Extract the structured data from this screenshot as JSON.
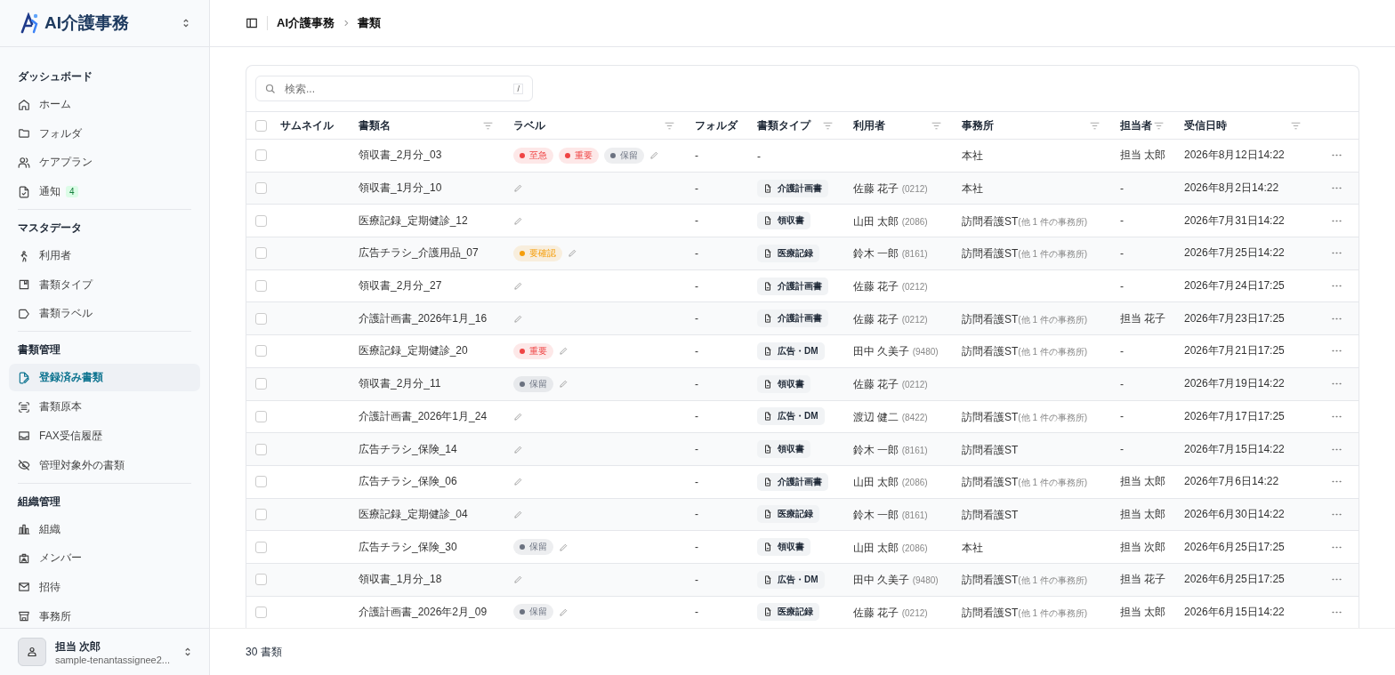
{
  "sidebar": {
    "app_name": "AI介護事務",
    "sections": [
      {
        "title": "ダッシュボード",
        "items": [
          {
            "label": "ホーム",
            "selected": false
          },
          {
            "label": "フォルダ",
            "selected": false
          },
          {
            "label": "ケアプラン",
            "selected": false
          },
          {
            "label": "通知",
            "selected": false,
            "badge": "4"
          }
        ]
      },
      {
        "title": "マスタデータ",
        "items": [
          {
            "label": "利用者",
            "selected": false
          },
          {
            "label": "書類タイプ",
            "selected": false
          },
          {
            "label": "書類ラベル",
            "selected": false
          }
        ]
      },
      {
        "title": "書類管理",
        "items": [
          {
            "label": "登録済み書類",
            "selected": true
          },
          {
            "label": "書類原本",
            "selected": false
          },
          {
            "label": "FAX受信履歴",
            "selected": false
          },
          {
            "label": "管理対象外の書類",
            "selected": false
          }
        ]
      },
      {
        "title": "組織管理",
        "items": [
          {
            "label": "組織",
            "selected": false
          },
          {
            "label": "メンバー",
            "selected": false
          },
          {
            "label": "招待",
            "selected": false
          },
          {
            "label": "事務所",
            "selected": false
          }
        ]
      }
    ],
    "user": {
      "name": "担当 次郎",
      "email": "sample-tenantassignee2..."
    }
  },
  "breadcrumb": [
    "AI介護事務",
    "書類"
  ],
  "search": {
    "placeholder": "検索...",
    "shortcut": "/"
  },
  "table": {
    "select_all": {
      "checked": false
    },
    "columns": [
      {
        "label": "サムネイル",
        "filter": false
      },
      {
        "label": "書類名",
        "filter": true
      },
      {
        "label": "ラベル",
        "filter": true
      },
      {
        "label": "フォルダ",
        "filter": false
      },
      {
        "label": "書類タイプ",
        "filter": true
      },
      {
        "label": "利用者",
        "filter": true
      },
      {
        "label": "事務所",
        "filter": true
      },
      {
        "label": "担当者",
        "filter": true
      },
      {
        "label": "受信日時",
        "filter": true
      }
    ],
    "rows": [
      {
        "checked": false,
        "name": "領収書_2月分_03",
        "labels": [
          {
            "text": "至急",
            "color": "#ef4444"
          },
          {
            "text": "重要",
            "color": "#ef4444"
          },
          {
            "text": "保留",
            "color": "#6b7280"
          }
        ],
        "folder": "-",
        "doc_type": {
          "kind": "plain",
          "text": "-"
        },
        "office": "本社",
        "assignee": "担当 太郎",
        "received": "2026年8月12日14:22"
      },
      {
        "checked": false,
        "name": "領収書_1月分_10",
        "labels": [],
        "folder": "-",
        "doc_type": {
          "kind": "chip",
          "text": "介護計画書"
        },
        "user": {
          "name": "佐藤 花子",
          "code": "(0212)"
        },
        "office": "本社",
        "assignee": "-",
        "received": "2026年8月2日14:22"
      },
      {
        "checked": false,
        "name": "医療記録_定期健診_12",
        "labels": [],
        "folder": "-",
        "doc_type": {
          "kind": "chip",
          "text": "領収書"
        },
        "user": {
          "name": "山田 太郎",
          "code": "(2086)"
        },
        "office": "訪問看護ST",
        "office_note": "(他 1 件の事務所)",
        "assignee": "-",
        "received": "2026年7月31日14:22"
      },
      {
        "checked": false,
        "name": "広告チラシ_介護用品_07",
        "labels": [
          {
            "text": "要確認",
            "color": "#f59e0b"
          }
        ],
        "folder": "-",
        "doc_type": {
          "kind": "chip",
          "text": "医療記録"
        },
        "user": {
          "name": "鈴木 一郎",
          "code": "(8161)"
        },
        "office": "訪問看護ST",
        "office_note": "(他 1 件の事務所)",
        "assignee": "-",
        "received": "2026年7月25日14:22"
      },
      {
        "checked": false,
        "name": "領収書_2月分_27",
        "labels": [],
        "folder": "-",
        "doc_type": {
          "kind": "chip",
          "text": "介護計画書"
        },
        "user": {
          "name": "佐藤 花子",
          "code": "(0212)"
        },
        "assignee": "-",
        "received": "2026年7月24日17:25"
      },
      {
        "checked": false,
        "name": "介護計画書_2026年1月_16",
        "labels": [],
        "folder": "-",
        "doc_type": {
          "kind": "chip",
          "text": "介護計画書"
        },
        "user": {
          "name": "佐藤 花子",
          "code": "(0212)"
        },
        "office": "訪問看護ST",
        "office_note": "(他 1 件の事務所)",
        "assignee": "担当 花子",
        "received": "2026年7月23日17:25"
      },
      {
        "checked": false,
        "name": "医療記録_定期健診_20",
        "labels": [
          {
            "text": "重要",
            "color": "#ef4444"
          }
        ],
        "folder": "-",
        "doc_type": {
          "kind": "chip",
          "text": "広告・DM"
        },
        "user": {
          "name": "田中 久美子",
          "code": "(9480)"
        },
        "office": "訪問看護ST",
        "office_note": "(他 1 件の事務所)",
        "assignee": "-",
        "received": "2026年7月21日17:25"
      },
      {
        "checked": false,
        "name": "領収書_2月分_11",
        "labels": [
          {
            "text": "保留",
            "color": "#6b7280"
          }
        ],
        "folder": "-",
        "doc_type": {
          "kind": "chip",
          "text": "領収書"
        },
        "user": {
          "name": "佐藤 花子",
          "code": "(0212)"
        },
        "assignee": "-",
        "received": "2026年7月19日14:22"
      },
      {
        "checked": false,
        "name": "介護計画書_2026年1月_24",
        "labels": [],
        "folder": "-",
        "doc_type": {
          "kind": "chip",
          "text": "広告・DM"
        },
        "user": {
          "name": "渡辺 健二",
          "code": "(8422)"
        },
        "office": "訪問看護ST",
        "office_note": "(他 1 件の事務所)",
        "assignee": "-",
        "received": "2026年7月17日17:25"
      },
      {
        "checked": false,
        "name": "広告チラシ_保険_14",
        "labels": [],
        "folder": "-",
        "doc_type": {
          "kind": "chip",
          "text": "領収書"
        },
        "user": {
          "name": "鈴木 一郎",
          "code": "(8161)"
        },
        "office": "訪問看護ST",
        "assignee": "-",
        "received": "2026年7月15日14:22"
      },
      {
        "checked": false,
        "name": "広告チラシ_保険_06",
        "labels": [],
        "folder": "-",
        "doc_type": {
          "kind": "chip",
          "text": "介護計画書"
        },
        "user": {
          "name": "山田 太郎",
          "code": "(2086)"
        },
        "office": "訪問看護ST",
        "office_note": "(他 1 件の事務所)",
        "assignee": "担当 太郎",
        "received": "2026年7月6日14:22"
      },
      {
        "checked": false,
        "name": "医療記録_定期健診_04",
        "labels": [],
        "folder": "-",
        "doc_type": {
          "kind": "chip",
          "text": "医療記録"
        },
        "user": {
          "name": "鈴木 一郎",
          "code": "(8161)"
        },
        "office": "訪問看護ST",
        "assignee": "担当 太郎",
        "received": "2026年6月30日14:22"
      },
      {
        "checked": false,
        "name": "広告チラシ_保険_30",
        "labels": [
          {
            "text": "保留",
            "color": "#6b7280"
          }
        ],
        "folder": "-",
        "doc_type": {
          "kind": "chip",
          "text": "領収書"
        },
        "user": {
          "name": "山田 太郎",
          "code": "(2086)"
        },
        "office": "本社",
        "assignee": "担当 次郎",
        "received": "2026年6月25日17:25"
      },
      {
        "checked": false,
        "name": "領収書_1月分_18",
        "labels": [],
        "folder": "-",
        "doc_type": {
          "kind": "chip",
          "text": "広告・DM"
        },
        "user": {
          "name": "田中 久美子",
          "code": "(9480)"
        },
        "office": "訪問看護ST",
        "office_note": "(他 1 件の事務所)",
        "assignee": "担当 花子",
        "received": "2026年6月25日17:25"
      },
      {
        "checked": false,
        "name": "介護計画書_2026年2月_09",
        "labels": [
          {
            "text": "保留",
            "color": "#6b7280"
          }
        ],
        "folder": "-",
        "doc_type": {
          "kind": "chip",
          "text": "医療記録"
        },
        "user": {
          "name": "佐藤 花子",
          "code": "(0212)"
        },
        "office": "訪問看護ST",
        "office_note": "(他 1 件の事務所)",
        "assignee": "担当 太郎",
        "received": "2026年6月15日14:22"
      }
    ]
  },
  "footer": {
    "count": "30 書類"
  }
}
